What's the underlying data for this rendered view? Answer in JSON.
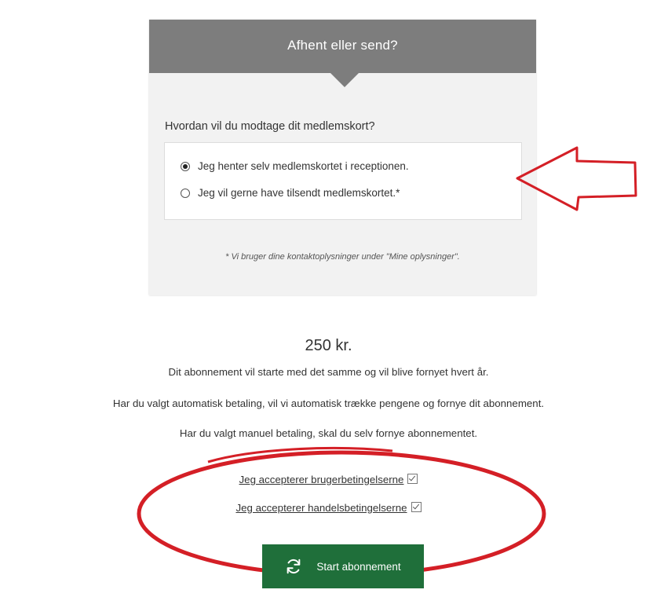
{
  "card": {
    "title": "Afhent eller send?",
    "question": "Hvordan vil du modtage dit medlemskort?",
    "options": [
      {
        "label": "Jeg henter selv medlemskortet i receptionen.",
        "selected": true
      },
      {
        "label": "Jeg vil gerne have tilsendt medlemskortet.*",
        "selected": false
      }
    ],
    "footnote": "* Vi bruger dine kontaktoplysninger under \"Mine oplysninger\"."
  },
  "summary": {
    "price": "250 kr.",
    "lines": [
      "Dit abonnement vil starte med det samme og vil blive fornyet hvert år.",
      "Har du valgt automatisk betaling, vil vi automatisk trække pengene og fornye dit abonnement.",
      "Har du valgt manuel betaling, skal du selv fornye abonnementet."
    ]
  },
  "terms": {
    "user_terms": "Jeg accepterer brugerbetingelserne",
    "user_terms_checked": true,
    "trade_terms": "Jeg accepterer handelsbetingelserne",
    "trade_terms_checked": true
  },
  "actions": {
    "start_label": "Start abonnement",
    "start_icon": "refresh-icon"
  },
  "colors": {
    "header_bg": "#7d7d7d",
    "card_bg": "#f2f2f2",
    "button_bg": "#1f6f3a",
    "annotation_red": "#d41f26"
  }
}
